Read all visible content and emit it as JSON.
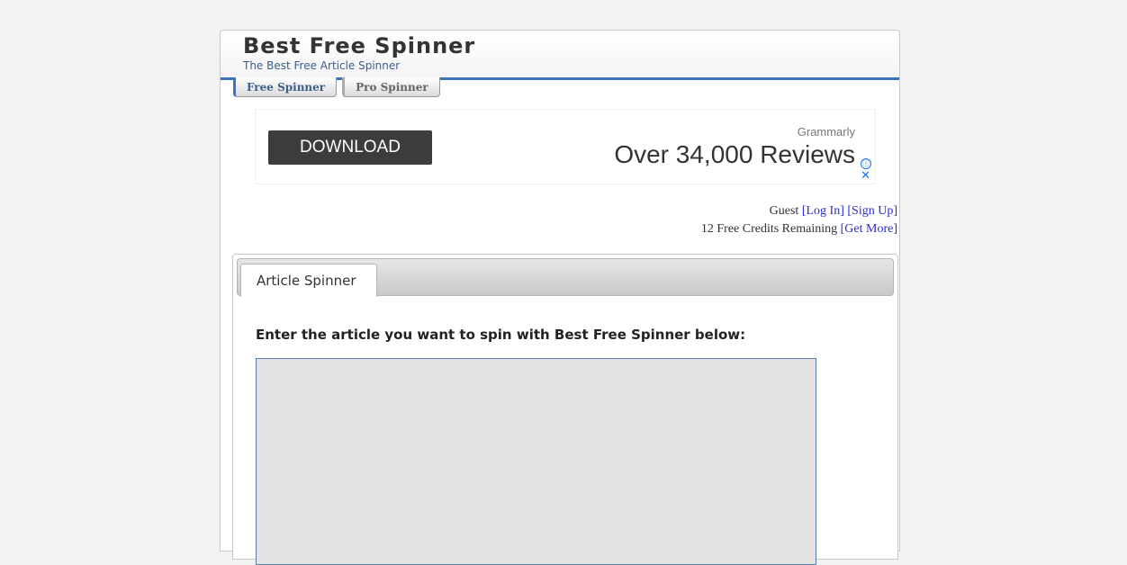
{
  "site": {
    "title": "Best Free Spinner",
    "subtitle": "The Best Free Article Spinner"
  },
  "nav": {
    "tabs": [
      {
        "label": "Free Spinner",
        "active": true
      },
      {
        "label": "Pro Spinner",
        "active": false
      }
    ]
  },
  "ad": {
    "button_label": "DOWNLOAD",
    "brand": "Grammarly",
    "headline": "Over 34,000 Reviews",
    "info_icon": "ⓘ",
    "close_icon": "✕"
  },
  "user": {
    "status": "Guest",
    "login_label": "[Log In]",
    "signup_label": "[Sign Up]",
    "credits_text": "12 Free Credits Remaining",
    "get_more_label": "[Get More]"
  },
  "panel": {
    "tab_label": "Article Spinner",
    "instruction": "Enter the article you want to spin with Best Free Spinner below:",
    "input_value": "",
    "input_placeholder": ""
  },
  "colors": {
    "accent": "#3a74c0",
    "link": "#2b2bd6",
    "input_bg": "#e3e3e3"
  }
}
